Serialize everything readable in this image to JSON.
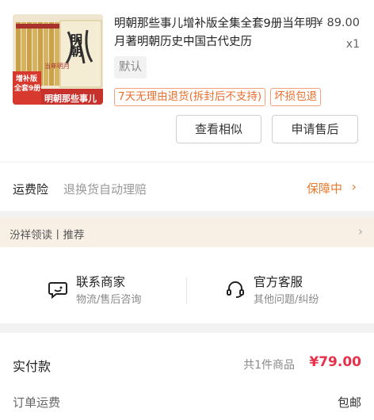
{
  "order_item": {
    "title": "明朝那些事儿增补版全集全套9册当年明月著明朝历史中国古代史历",
    "price": "¥ 89.00",
    "quantity": "x1",
    "spec": "默认",
    "tags": [
      "7天无理由退货(拆封后不支持)",
      "坏损包退"
    ],
    "cover": {
      "banner_title": "明朝那些事儿",
      "badge_line1": "增补版",
      "badge_line2": "全套9册",
      "badge_line3": "当年明月",
      "spine_title": "明朝"
    },
    "buttons": {
      "similar": "查看相似",
      "after_sale": "申请售后"
    }
  },
  "insurance": {
    "label": "运费险",
    "desc": "退换货自动理赔",
    "status": "保障中"
  },
  "shop_bar": {
    "text": "汾祥领读丨推荐"
  },
  "contact": {
    "merchant_title": "联系商家",
    "merchant_sub": "物流/售后咨询",
    "service_title": "官方客服",
    "service_sub": "其他问题/纠纷"
  },
  "summary": {
    "paid_label": "实付款",
    "item_count": "共1件商品",
    "paid_amount": "¥79.00",
    "shipping_label": "订单运费",
    "shipping_value": "包邮"
  },
  "colors": {
    "accent_orange": "#e87a2c",
    "price_red": "#e8304a",
    "tag_border": "#f3a27a",
    "shop_bar_bg": "#f8efe5"
  },
  "icons": [
    "chevron-right-icon",
    "chat-merchant-icon",
    "headset-icon"
  ]
}
